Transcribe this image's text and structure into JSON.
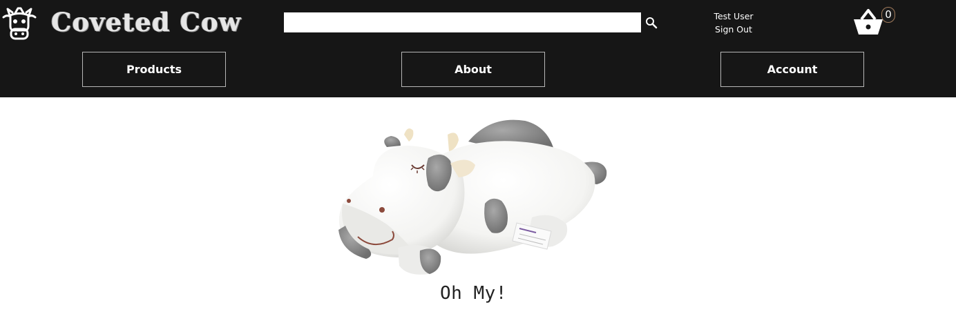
{
  "header": {
    "brand_name": "Coveted Cow",
    "logo_icon": "cow-head-icon",
    "search": {
      "value": "",
      "placeholder": "",
      "button_icon": "search-icon"
    },
    "user": {
      "name": "Test User",
      "sign_out_label": "Sign Out"
    },
    "cart": {
      "icon": "basket-icon",
      "count": "0"
    },
    "background_color": "#161616"
  },
  "nav": {
    "items": [
      {
        "label": "Products"
      },
      {
        "label": "About"
      },
      {
        "label": "Account"
      }
    ]
  },
  "main": {
    "hero_image": "cow-plush-toy",
    "caption": "Oh My!"
  }
}
